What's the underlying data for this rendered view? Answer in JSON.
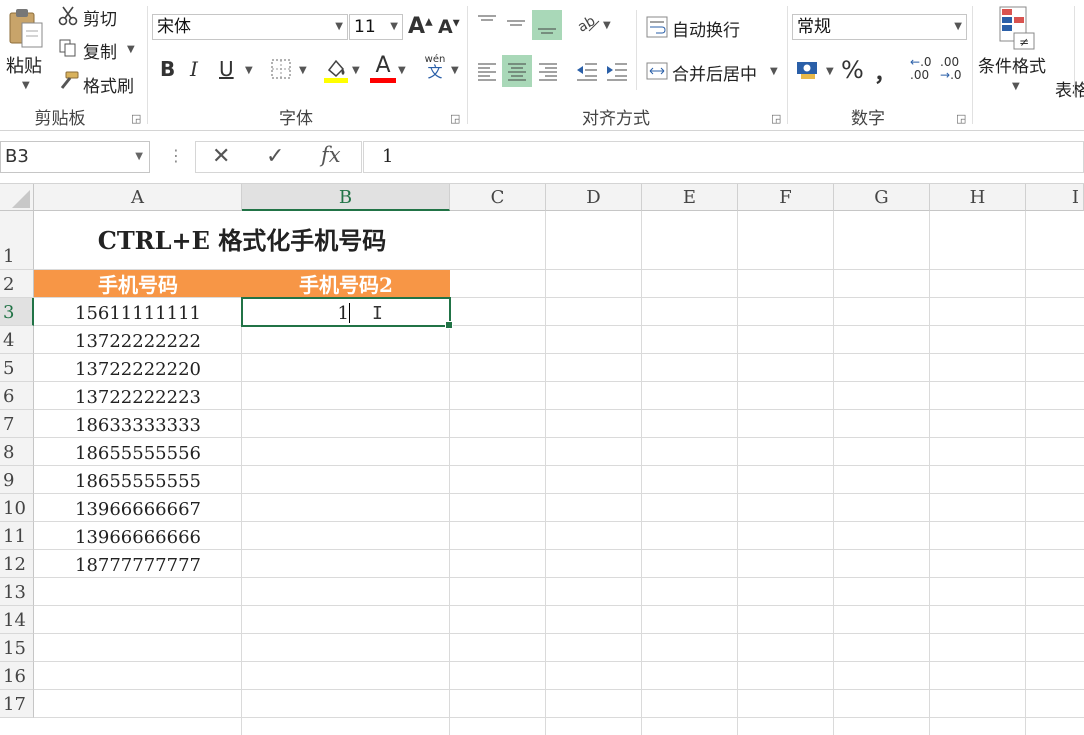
{
  "ribbon": {
    "clipboard": {
      "paste": "粘贴",
      "cut": "剪切",
      "copy": "复制",
      "format_painter": "格式刷",
      "group_label": "剪贴板"
    },
    "font": {
      "font_name": "宋体",
      "font_size": "11",
      "grow": "A",
      "shrink": "A",
      "bold": "B",
      "italic": "I",
      "underline": "U",
      "font_color": "A",
      "phonetic_top": "wén",
      "phonetic_bottom": "文",
      "group_label": "字体",
      "fill_color": "#ffff00",
      "font_color_bar": "#ff0000"
    },
    "alignment": {
      "wrap_text": "自动换行",
      "merge_center": "合并后居中",
      "group_label": "对齐方式"
    },
    "number": {
      "format": "常规",
      "percent": "%",
      "comma": "，",
      "inc_decimal": ".00",
      "dec_decimal": ".0",
      "group_label": "数字"
    },
    "styles": {
      "conditional_format": "条件格式",
      "table_format": "表格"
    }
  },
  "formula_bar": {
    "name_box": "B3",
    "cancel": "✕",
    "enter": "✓",
    "fx": "fx",
    "content": "1"
  },
  "sheet": {
    "columns": [
      "A",
      "B",
      "C",
      "D",
      "E",
      "F",
      "G",
      "H",
      "I"
    ],
    "rows": [
      "1",
      "2",
      "3",
      "4",
      "5",
      "6",
      "7",
      "8",
      "9",
      "10",
      "11",
      "12",
      "13",
      "14",
      "15",
      "16",
      "17"
    ],
    "title": "CTRL+E 格式化手机号码",
    "header_a": "手机号码",
    "header_b": "手机号码2",
    "header_color": "#f79646",
    "editing_value": "1",
    "phones": [
      "15611111111",
      "13722222222",
      "13722222220",
      "13722222223",
      "18633333333",
      "18655555556",
      "18655555555",
      "13966666667",
      "13966666666",
      "18777777777"
    ]
  }
}
